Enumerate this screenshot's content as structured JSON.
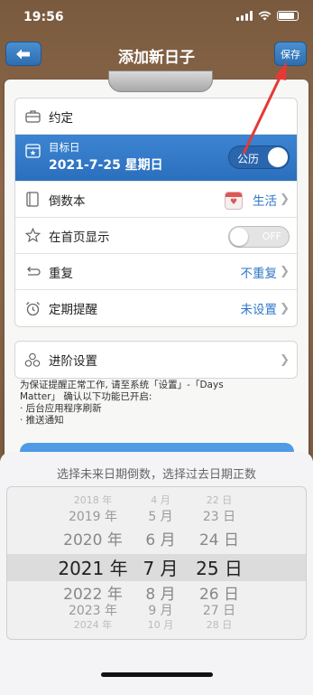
{
  "status": {
    "time": "19:56"
  },
  "nav": {
    "title": "添加新日子",
    "save_label": "保存"
  },
  "form": {
    "title_placeholder": "约定",
    "target": {
      "label": "目标日",
      "date": "2021-7-25 星期日",
      "calendar_toggle": "公历"
    },
    "book": {
      "label": "倒数本",
      "value": "生活"
    },
    "homepage": {
      "label": "在首页显示",
      "toggle": "OFF"
    },
    "repeat": {
      "label": "重复",
      "value": "不重复"
    },
    "reminder": {
      "label": "定期提醒",
      "value": "未设置"
    },
    "advanced": {
      "label": "进阶设置"
    }
  },
  "note": {
    "line1": "为保证提醒正常工作, 请至系统「设置」-「Days",
    "line2": "Matter」 确认以下功能已开启:",
    "line3": "· 后台应用程序刷新",
    "line4": "· 推送通知"
  },
  "picker": {
    "hint": "选择未来日期倒数，选择过去日期正数",
    "years": [
      "2018 年",
      "2019 年",
      "2020 年",
      "2021 年",
      "2022 年",
      "2023 年",
      "2024 年"
    ],
    "months": [
      "4 月",
      "5 月",
      "6 月",
      "7 月",
      "8 月",
      "9 月",
      "10 月"
    ],
    "days": [
      "22 日",
      "23 日",
      "24 日",
      "25 日",
      "26 日",
      "27 日",
      "28 日"
    ],
    "selected_index": 3
  },
  "colors": {
    "accent": "#2f77c8",
    "annotation_arrow": "#e53935"
  }
}
